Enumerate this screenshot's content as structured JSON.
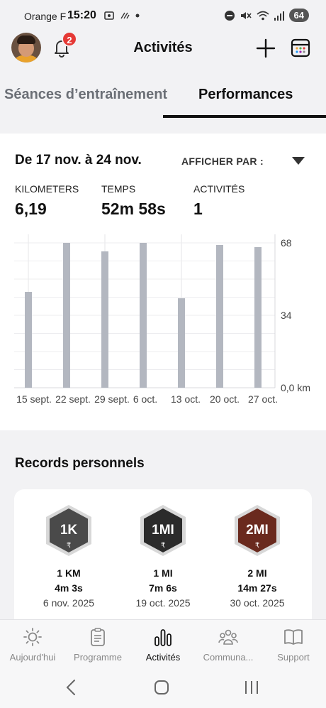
{
  "status_bar": {
    "carrier": "Orange F",
    "time": "15:20",
    "battery": "64"
  },
  "header": {
    "title": "Activités",
    "notification_count": "2"
  },
  "tabs": [
    {
      "label": "Séances d’entraînement",
      "active": false
    },
    {
      "label": "Performances",
      "active": true
    }
  ],
  "summary": {
    "date_range": "De 17 nov. à 24 nov.",
    "display_by_label": "AFFICHER PAR :",
    "stats": [
      {
        "label": "KILOMETERS",
        "value": "6,19"
      },
      {
        "label": "TEMPS",
        "value": "52m 58s"
      },
      {
        "label": "ACTIVITÉS",
        "value": "1"
      }
    ]
  },
  "chart_data": {
    "type": "bar",
    "categories": [
      "15 sept.",
      "22 sept.",
      "29 sept.",
      "6 oct.",
      "13 oct.",
      "20 oct.",
      "27 oct."
    ],
    "values": [
      45,
      68,
      64,
      68,
      42,
      67,
      66
    ],
    "x_tick_labels": [
      "15 sept.",
      "22 sept.",
      "29 sept.",
      "6 oct.",
      "",
      "13 oct.",
      "20 oct.",
      "27 oct."
    ],
    "y_ticks": [
      "68",
      "34",
      "0,0 km"
    ],
    "ylim": [
      0,
      68
    ],
    "bar_color": "#b3b7c0",
    "grid": true
  },
  "records": {
    "title": "Records personnels",
    "items": [
      {
        "badge": "1K",
        "distance": "1 KM",
        "time": "4m 3s",
        "date": "6 nov. 2025",
        "color": "#4a4a4a"
      },
      {
        "badge": "1MI",
        "distance": "1 MI",
        "time": "7m 6s",
        "date": "19 oct. 2025",
        "color": "#2b2b2b"
      },
      {
        "badge": "2MI",
        "distance": "2 MI",
        "time": "14m 27s",
        "date": "30 oct. 2025",
        "color": "#6a2a1e"
      }
    ]
  },
  "nav": {
    "items": [
      {
        "label": "Aujourd'hui",
        "icon": "sun-icon",
        "active": false
      },
      {
        "label": "Programme",
        "icon": "clipboard-icon",
        "active": false
      },
      {
        "label": "Activités",
        "icon": "bars-icon",
        "active": true
      },
      {
        "label": "Communa...",
        "icon": "community-icon",
        "active": false
      },
      {
        "label": "Support",
        "icon": "book-icon",
        "active": false
      }
    ]
  },
  "colors": {
    "accent": "#111111",
    "badge_red": "#e53935",
    "bar": "#b3b7c0"
  }
}
